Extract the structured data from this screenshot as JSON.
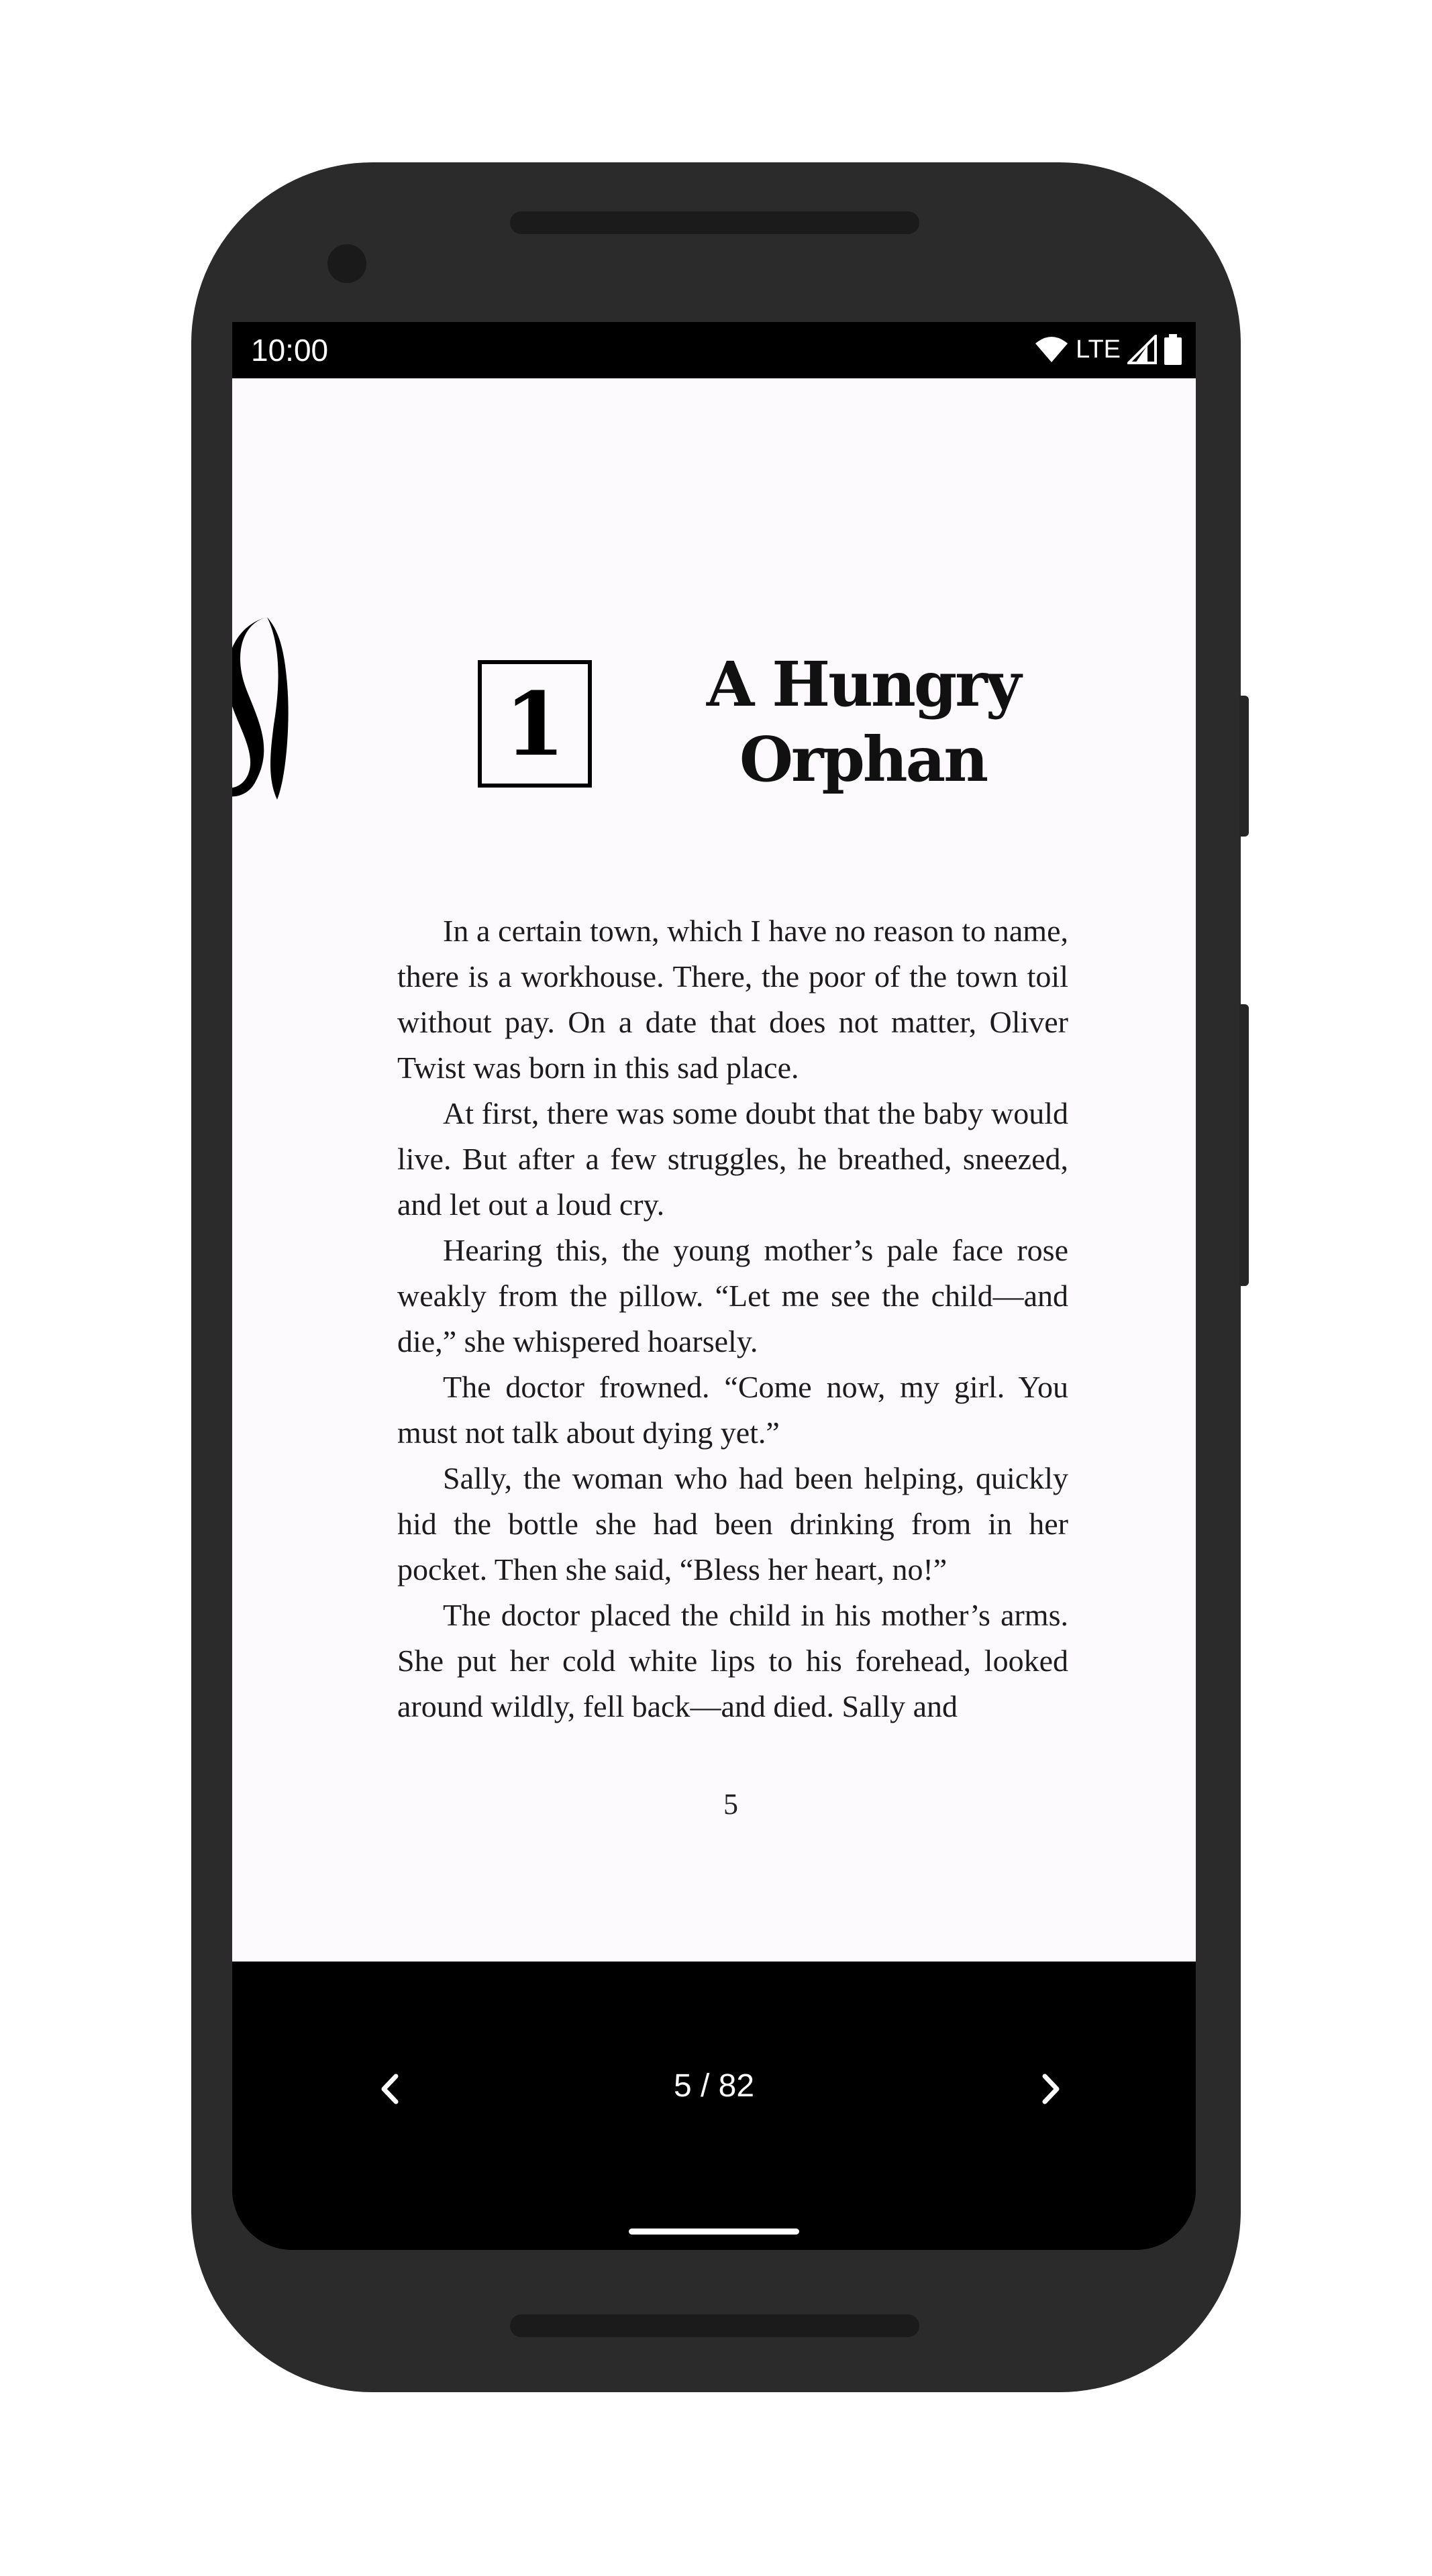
{
  "status_bar": {
    "time": "10:00",
    "network": "LTE"
  },
  "chapter": {
    "number": "1",
    "title_line1": "A Hungry",
    "title_line2": "Orphan"
  },
  "paragraphs": [
    "In a certain town, which I have no reason to name, there is a workhouse. There, the poor of the town toil without pay. On a date that does not matter, Oliver Twist was born in this sad place.",
    "At first, there was some doubt that the baby would live. But after a few struggles, he breathed, sneezed, and let out a loud cry.",
    "Hearing this, the young mother’s pale face rose weakly from the pillow. “Let me see the child—and die,” she whispered hoarsely.",
    "The doctor frowned. “Come now, my girl. You must not talk about dying yet.”",
    "Sally, the woman who had been helping, quickly hid the bottle she had been drinking from in her pocket. Then she said, “Bless her heart, no!”",
    "The doctor placed the child in his mother’s arms. She put her cold white lips to his forehead, looked around wildly, fell back—and died. Sally and"
  ],
  "page_number": "5",
  "navigation": {
    "page_indicator": "5 / 82",
    "prev_icon": "chevron-left-icon",
    "next_icon": "chevron-right-icon"
  }
}
